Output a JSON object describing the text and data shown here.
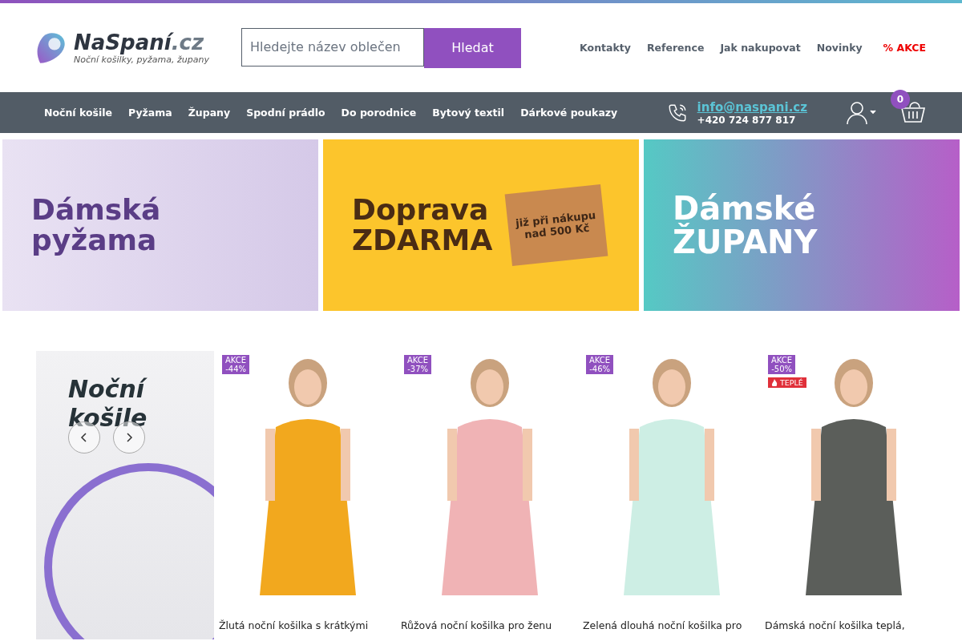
{
  "header": {
    "logo": {
      "name": "NaSpaní",
      "tld": ".cz",
      "tagline": "Noční košilky, pyžama, župany"
    },
    "search": {
      "placeholder": "Hledejte název oblečen",
      "button": "Hledat"
    },
    "top_links": [
      {
        "label": "Kontakty",
        "kind": "link"
      },
      {
        "label": "Reference",
        "kind": "link"
      },
      {
        "label": "Jak nakupovat",
        "kind": "link"
      },
      {
        "label": "Novinky",
        "kind": "link"
      },
      {
        "label": "% AKCE",
        "kind": "sale"
      }
    ]
  },
  "nav": {
    "items": [
      "Noční košile",
      "Pyžama",
      "Župany",
      "Spodní prádlo",
      "Do porodnice",
      "Bytový textil",
      "Dárkové poukazy"
    ],
    "email": "info@naspani.cz",
    "phone": "+420 724 877 817",
    "cart_count": "0"
  },
  "banners": [
    {
      "kind": "pajamas",
      "title_lines": [
        "Dámská",
        "pyžama"
      ]
    },
    {
      "kind": "shipping",
      "title_lines": [
        "Doprava",
        "ZDARMA"
      ],
      "box_text": [
        "již při nákupu",
        "nad 500 Kč"
      ]
    },
    {
      "kind": "robes",
      "title_lines": [
        "Dámské",
        "ŽUPANY"
      ]
    }
  ],
  "promo": {
    "title_lines": [
      "Noční",
      "košile"
    ]
  },
  "products": [
    {
      "badge": [
        "AKCE",
        "-44%"
      ],
      "title": "Žlutá noční košilka s krátkými"
    },
    {
      "badge": [
        "AKCE",
        "-37%"
      ],
      "title": "Růžová noční košilka pro ženu"
    },
    {
      "badge": [
        "AKCE",
        "-46%"
      ],
      "title": "Zelená dlouhá noční košilka pro"
    },
    {
      "badge": [
        "AKCE",
        "-50%"
      ],
      "tags": [
        "TEPLÉ"
      ],
      "title": "Dámská noční košilka teplá,"
    }
  ]
}
